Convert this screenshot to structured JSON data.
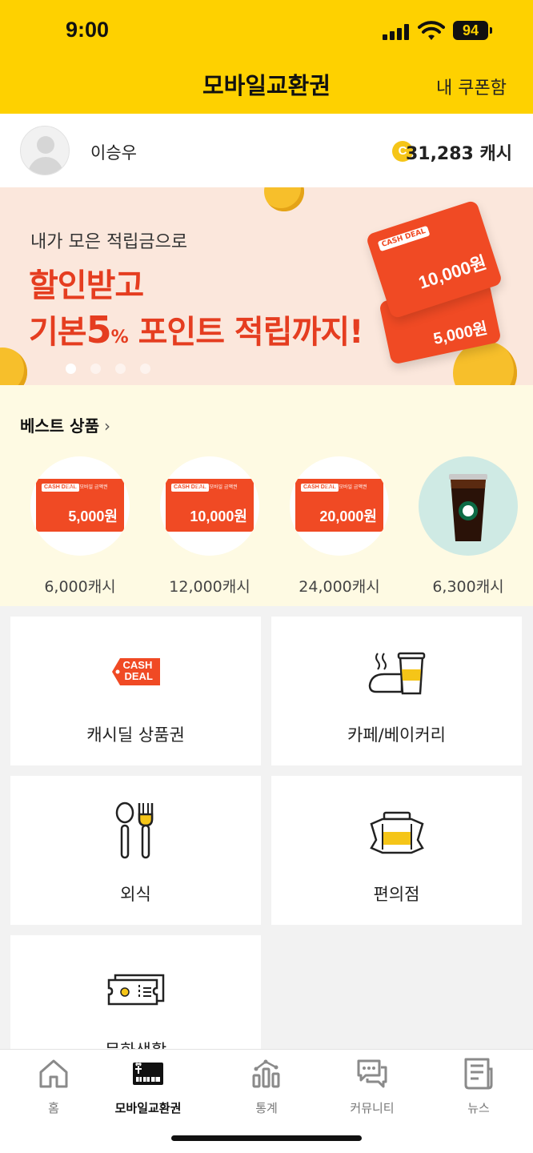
{
  "status_bar": {
    "time": "9:00",
    "battery": "94"
  },
  "header": {
    "title": "모바일교환권",
    "coupon_box": "내 쿠폰함"
  },
  "profile": {
    "name": "이승우",
    "coin_symbol": "C",
    "balance": "31,283 캐시"
  },
  "banner": {
    "subtitle": "내가 모은 적립금으로",
    "line1": "할인받고",
    "line2_prefix": "기본",
    "line2_num": "5",
    "line2_pct": "%",
    "line2_suffix": " 포인트 적립까지!",
    "card_big_amount": "10,000원",
    "card_small_amount": "5,000원",
    "card_tag": "CASH DEAL",
    "slide_index": 1,
    "slide_count": 4
  },
  "best": {
    "title": "베스트 상품",
    "chevron": "›",
    "products": [
      {
        "card_amount": "5,000원",
        "price": "6,000캐시"
      },
      {
        "card_amount": "10,000원",
        "price": "12,000캐시"
      },
      {
        "card_amount": "20,000원",
        "price": "24,000캐시"
      },
      {
        "price": "6,300캐시"
      }
    ],
    "card_tag": "CASH DEAL",
    "card_sub": "캐시딜 모바일 금액권"
  },
  "categories": [
    {
      "label": "캐시딜 상품권",
      "icon": "cash-deal-icon"
    },
    {
      "label": "카페/베이커리",
      "icon": "coffee-bread-icon"
    },
    {
      "label": "외식",
      "icon": "fork-spoon-icon"
    },
    {
      "label": "편의점",
      "icon": "store-jars-icon"
    },
    {
      "label": "문화생활",
      "icon": "ticket-icon"
    }
  ],
  "cash_deal_logo": {
    "line1": "CASH",
    "line2": "DEAL"
  },
  "bottom_nav": [
    {
      "label": "홈",
      "icon": "home-icon",
      "active": false
    },
    {
      "label": "모바일교환권",
      "icon": "gift-card-icon",
      "active": true
    },
    {
      "label": "통계",
      "icon": "stats-icon",
      "active": false
    },
    {
      "label": "커뮤니티",
      "icon": "chat-icon",
      "active": false
    },
    {
      "label": "뉴스",
      "icon": "news-icon",
      "active": false
    }
  ],
  "colors": {
    "accent_yellow": "#fed100",
    "cash_deal_red": "#f04a24",
    "banner_bg": "#fbe7dc",
    "best_bg": "#fefae3"
  }
}
